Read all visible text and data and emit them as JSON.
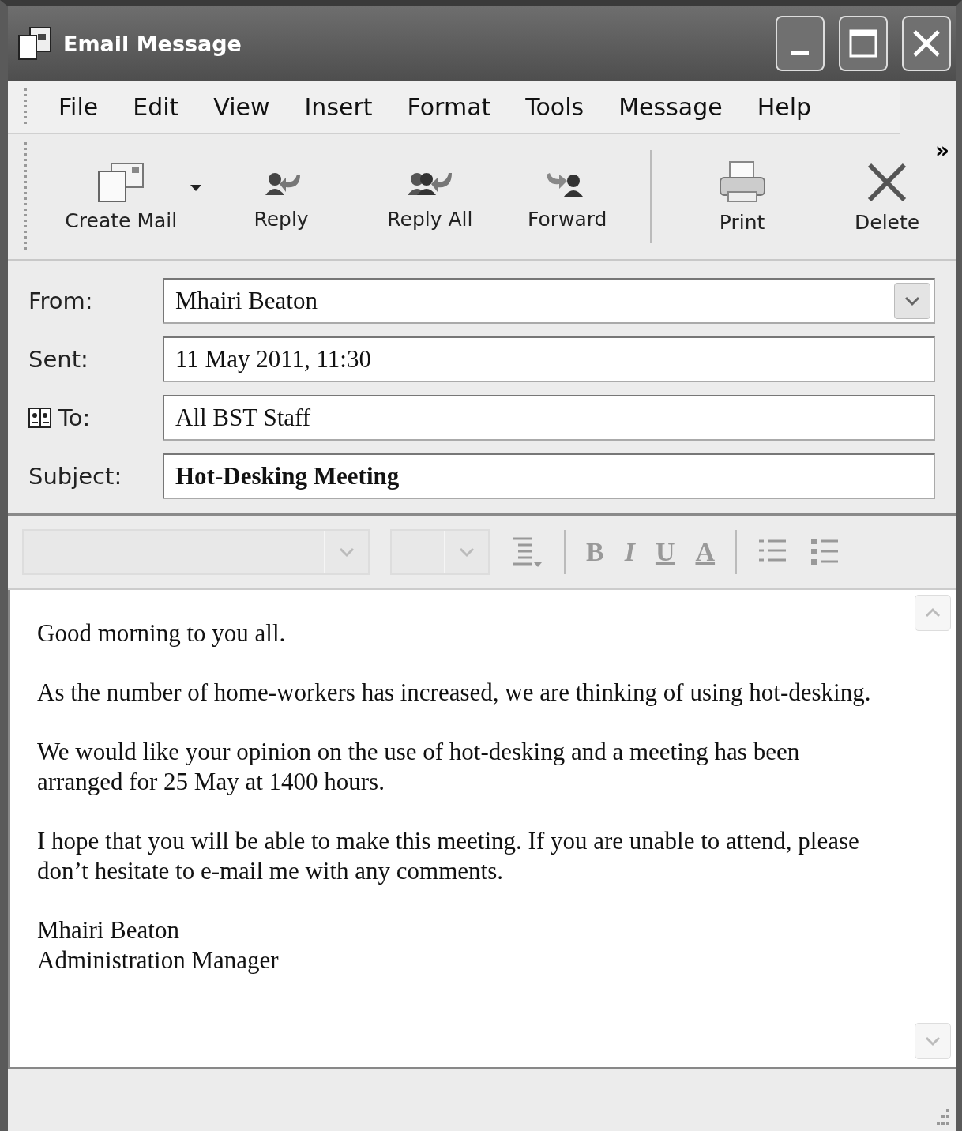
{
  "window": {
    "title": "Email Message"
  },
  "menu": [
    "File",
    "Edit",
    "View",
    "Insert",
    "Format",
    "Tools",
    "Message",
    "Help"
  ],
  "toolbar": [
    {
      "kind": "new",
      "label": "Create Mail",
      "dropdown": true
    },
    {
      "kind": "reply",
      "label": "Reply",
      "dropdown": false
    },
    {
      "kind": "replyall",
      "label": "Reply All",
      "dropdown": false
    },
    {
      "kind": "forward",
      "label": "Forward",
      "dropdown": false
    },
    {
      "kind": "print",
      "label": "Print",
      "dropdown": false
    },
    {
      "kind": "delete",
      "label": "Delete",
      "dropdown": false
    }
  ],
  "toolbar_more": "»",
  "header": [
    {
      "label": "From:",
      "value": "Mhairi Beaton",
      "kind": "dropdown",
      "bold": false
    },
    {
      "label": "Sent:",
      "value": "11 May 2011, 11:30",
      "kind": "text",
      "bold": false
    },
    {
      "label": "To:",
      "value": "All BST Staff",
      "kind": "addressbook",
      "bold": false
    },
    {
      "label": "Subject:",
      "value": "Hot-Desking Meeting",
      "kind": "text",
      "bold": true
    }
  ],
  "format_buttons": [
    {
      "label": "B",
      "kind": "bold"
    },
    {
      "label": "I",
      "kind": "italic"
    },
    {
      "label": "U",
      "kind": "underline"
    },
    {
      "label": "A",
      "kind": "color"
    }
  ],
  "body": [
    "Good morning to you all.",
    "As the number of home-workers has increased, we are thinking of using hot-desking.",
    "We would like your opinion on the use of hot-desking and a meeting has been arranged for 25 May at 1400 hours.",
    "I hope that you will be able to make this meeting.  If you are unable to attend, please don’t hesitate to e-mail me with any comments.",
    "Mhairi Beaton\nAdministration Manager"
  ]
}
